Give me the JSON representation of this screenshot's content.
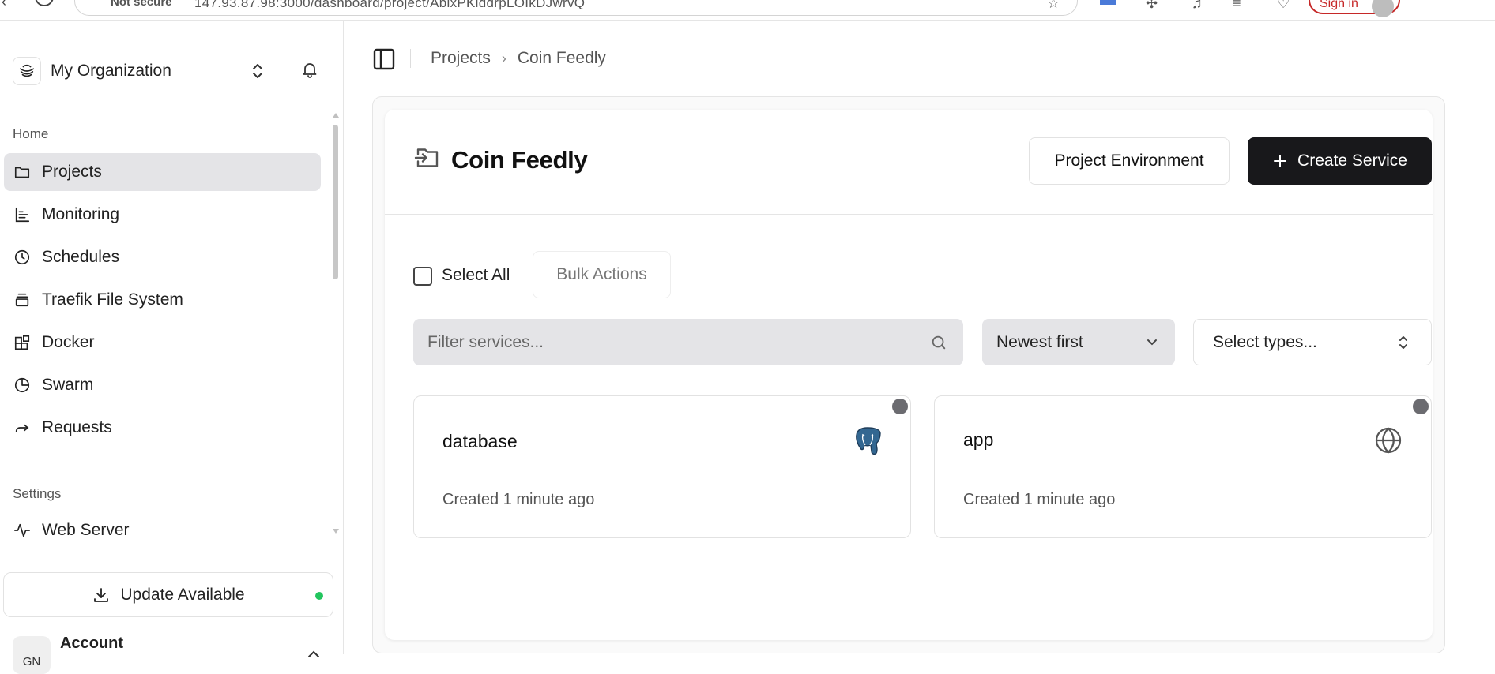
{
  "browser": {
    "security_label": "Not secure",
    "url": "147.93.87.98:3000/dashboard/project/AbixPKiddrpLOIkDJwrvQ",
    "sign_in_label": "Sign in"
  },
  "sidebar": {
    "org_name": "My Organization",
    "groups": {
      "home": "Home",
      "settings": "Settings"
    },
    "items": [
      {
        "label": "Projects",
        "icon": "folder-icon",
        "active": true
      },
      {
        "label": "Monitoring",
        "icon": "chart-icon",
        "active": false
      },
      {
        "label": "Schedules",
        "icon": "clock-icon",
        "active": false
      },
      {
        "label": "Traefik File System",
        "icon": "layers-icon",
        "active": false
      },
      {
        "label": "Docker",
        "icon": "blocks-icon",
        "active": false
      },
      {
        "label": "Swarm",
        "icon": "pie-icon",
        "active": false
      },
      {
        "label": "Requests",
        "icon": "forward-icon",
        "active": false
      }
    ],
    "settings_items": [
      {
        "label": "Web Server",
        "icon": "activity-icon"
      }
    ],
    "update_label": "Update Available",
    "account": {
      "initials": "GN",
      "label": "Account"
    }
  },
  "main": {
    "breadcrumb": [
      "Projects",
      "Coin Feedly"
    ],
    "project_title": "Coin Feedly",
    "env_button": "Project Environment",
    "create_button": "Create Service",
    "select_all": "Select All",
    "bulk_actions": "Bulk Actions",
    "filter_placeholder": "Filter services...",
    "sort_value": "Newest first",
    "types_placeholder": "Select types...",
    "services": [
      {
        "name": "database",
        "created": "Created 1 minute ago",
        "icon": "postgres-icon"
      },
      {
        "name": "app",
        "created": "Created 1 minute ago",
        "icon": "globe-icon"
      }
    ]
  },
  "colors": {
    "accent": "#18181b",
    "active_nav": "#e4e4e7",
    "status_green": "#22c55e",
    "status_gray": "#6b6b70",
    "postgres_blue": "#336791"
  }
}
